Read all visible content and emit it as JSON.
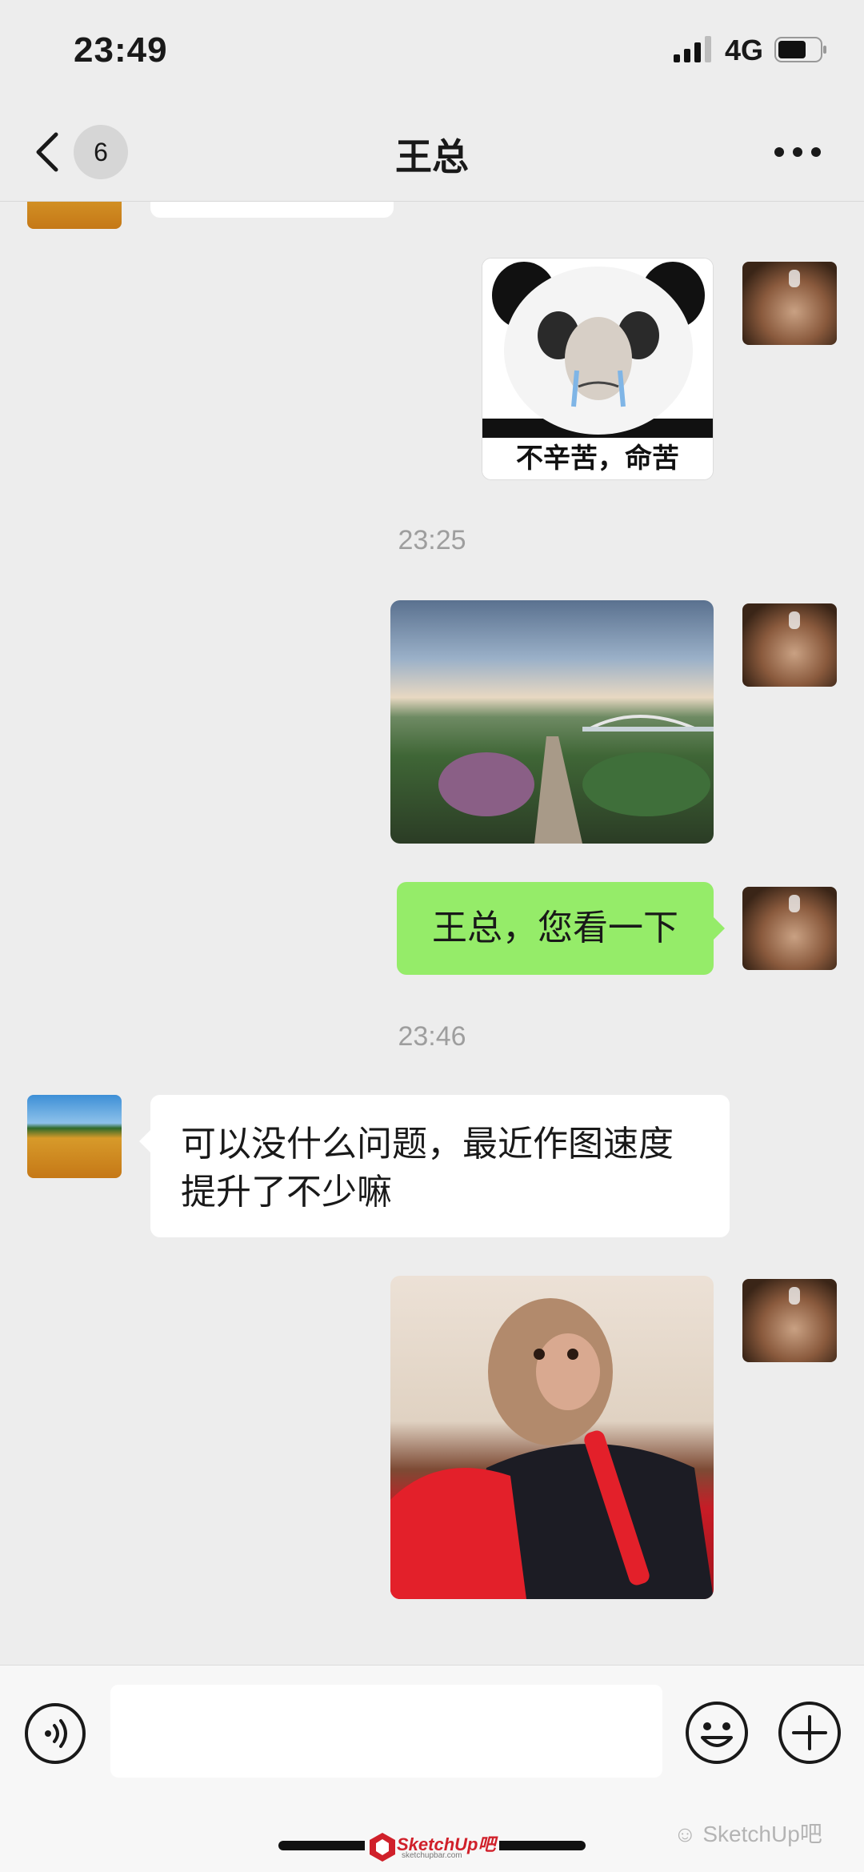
{
  "status_bar": {
    "time": "23:49",
    "network": "4G"
  },
  "nav": {
    "unread_count": "6",
    "title": "王总"
  },
  "messages": {
    "sticker_1_caption": "不辛苦，命苦",
    "timestamp_1": "23:25",
    "text_1": "王总，您看一下",
    "timestamp_2": "23:46",
    "text_2_line1": "可以没什么问题，最近作图速度",
    "text_2_line2": "提升了不少嘛"
  },
  "watermark": {
    "logo_text": "SketchUp吧",
    "logo_sub": "sketchupbar.com",
    "right_text": "SketchUp吧"
  },
  "icons": [
    "back-icon",
    "more-icon",
    "voice-icon",
    "emoji-icon",
    "plus-icon",
    "wechat-icon"
  ],
  "colors": {
    "background": "#ededed",
    "sent_bubble": "#95ec69",
    "received_bubble": "#ffffff",
    "input_bar": "#f7f7f7"
  }
}
